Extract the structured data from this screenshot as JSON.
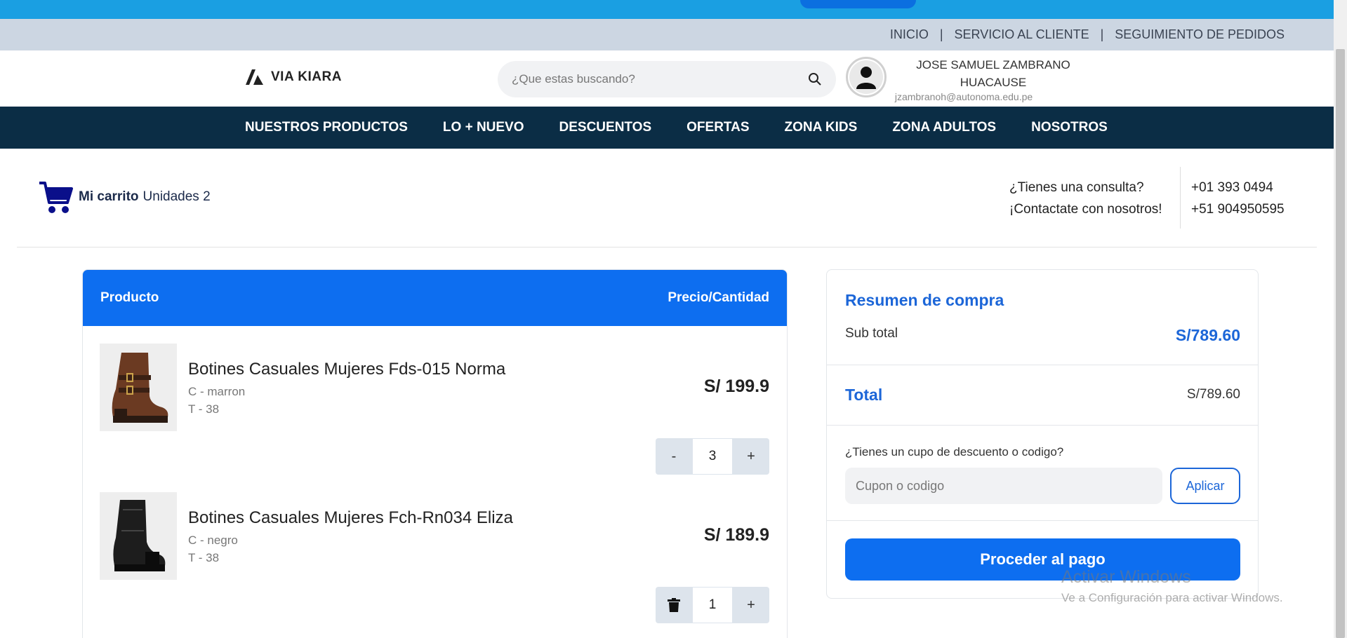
{
  "util_nav": [
    "INICIO",
    "SERVICIO AL CLIENTE",
    "SEGUIMIENTO DE PEDIDOS"
  ],
  "util_sep": "|",
  "brand": {
    "name": "VIA KIARA"
  },
  "search": {
    "placeholder": "¿Que estas buscando?"
  },
  "user": {
    "name_line1": "JOSE SAMUEL ZAMBRANO",
    "name_line2": "HUACAUSE",
    "email": "jzambranoh@autonoma.edu.pe"
  },
  "main_nav": [
    "NUESTROS PRODUCTOS",
    "LO + NUEVO",
    "DESCUENTOS",
    "OFERTAS",
    "ZONA KIDS",
    "ZONA ADULTOS",
    "NOSOTROS"
  ],
  "cart": {
    "label": "Mi carrito",
    "units": "Unidades 2"
  },
  "contact": {
    "line1": "¿Tienes una consulta?",
    "line2": "¡Contactate con nosotros!",
    "phone1": "+01 393 0494",
    "phone2": "+51 904950595"
  },
  "table": {
    "col_product": "Producto",
    "col_price": "Precio/Cantidad"
  },
  "items": [
    {
      "name": "Botines Casuales Mujeres Fds-015 Norma",
      "color": "C - marron",
      "size": "T - 38",
      "price": "S/ 199.9",
      "qty": "3",
      "minus": "-",
      "plus": "+"
    },
    {
      "name": "Botines Casuales Mujeres Fch-Rn034 Eliza",
      "color": "C - negro",
      "size": "T - 38",
      "price": "S/ 189.9",
      "qty": "1",
      "plus": "+"
    }
  ],
  "summary": {
    "title": "Resumen de compra",
    "subtotal_label": "Sub total",
    "subtotal_value": "S/789.60",
    "total_label": "Total",
    "total_value": "S/789.60",
    "coupon_question": "¿Tienes un cupo de descuento o codigo?",
    "coupon_placeholder": "Cupon o codigo",
    "apply_label": "Aplicar",
    "pay_label": "Proceder al pago"
  },
  "watermark": {
    "line1": "Activar Windows",
    "line2": "Ve a Configuración para activar Windows."
  },
  "colors": {
    "primary": "#0d6ef0",
    "nav_bg": "#0b2d45",
    "util_bg": "#ccd6e2",
    "accent_text": "#1c66d8"
  }
}
